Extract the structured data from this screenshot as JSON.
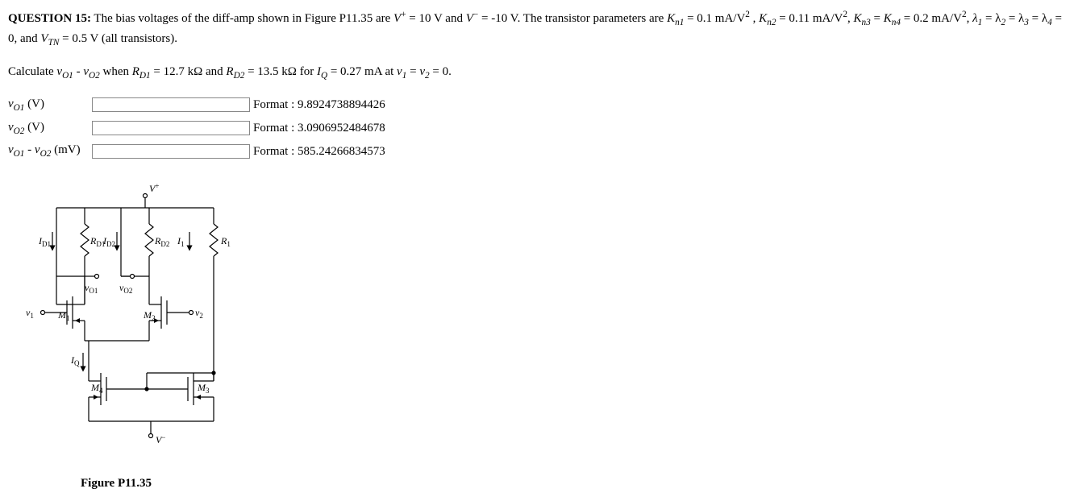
{
  "question": {
    "number": "QUESTION 15:",
    "line1_a": " The bias voltages of the diff-amp shown in Figure P11.35 are ",
    "Vplus_label": "V",
    "Vplus_sup": "+",
    "Vplus_eq": " = 10 V and ",
    "Vminus_label": "V",
    "Vminus_sup": "−",
    "Vminus_eq": " = -10 V. The transistor parameters are ",
    "Kn1": "K",
    "Kn1_sub": "n1",
    "Kn1_eq": " = 0.1 mA/V",
    "sq": "2",
    "comma_sp": " , ",
    "Kn2": "K",
    "Kn2_sub": "n2",
    "Kn2_eq": " = 0.11 mA/V",
    "comma": ", ",
    "Kn3": "K",
    "Kn3_sub": "n3",
    "Kn3_eq": " = ",
    "Kn4": "K",
    "Kn4_sub": "n4",
    "Kn4_eq": " = 0.2 mA/V",
    "lambda1": "λ",
    "lambda1_sub": "1",
    "lambda1_eq": " = ",
    "line2_a": "λ",
    "l2_sub": "2",
    "line2_b": " = λ",
    "l3_sub": "3",
    "line2_c": " = λ",
    "l4_sub": "4",
    "line2_d": " = 0, and ",
    "VTN": "V",
    "VTN_sub": "TN",
    "VTN_eq": " = 0.5 V (all transistors).",
    "calc_a": "Calculate ",
    "vo1": "v",
    "o1_sub": "O1",
    "minus": " - ",
    "vo2": "v",
    "o2_sub": "O2",
    "calc_b": " when ",
    "RD1": "R",
    "RD1_sub": "D1",
    "RD1_eq": " = 12.7 kΩ and ",
    "RD2": "R",
    "RD2_sub": "D2",
    "RD2_eq": " = 13.5 kΩ for ",
    "IQ": "I",
    "IQ_sub": "Q",
    "IQ_eq": " = 0.27 mA at ",
    "v1": "v",
    "v1_sub": "1",
    "v1_eq": " = ",
    "v2": "v",
    "v2_sub": "2",
    "v2_eq": " = 0."
  },
  "answers": [
    {
      "label_var": "v",
      "label_sub": "O1",
      "label_unit": " (V)",
      "format": "Format : 9.8924738894426"
    },
    {
      "label_var": "v",
      "label_sub": "O2",
      "label_unit": " (V)",
      "format": "Format : 3.0906952484678"
    },
    {
      "label_var": "v",
      "label_sub": "O1",
      "label_mid": " - ",
      "label_var2": "v",
      "label_sub2": "O2",
      "label_unit": " (mV)",
      "format": "Format : 585.24266834573"
    }
  ],
  "figure": {
    "caption": "Figure P11.35",
    "labels": {
      "Vplus": "V",
      "Vplus_sup": "+",
      "Vminus": "V",
      "Vminus_sup": "−",
      "ID1": "I",
      "ID1_sub": "D1",
      "ID2": "I",
      "ID2_sub": "D2",
      "RD1": "R",
      "RD1_sub": "D1",
      "RD2": "R",
      "RD2_sub": "D2",
      "I1": "I",
      "I1_sub": "1",
      "R1": "R",
      "R1_sub": "1",
      "vO1": "v",
      "vO1_sub": "O1",
      "vO2": "v",
      "vO2_sub": "O2",
      "v1": "v",
      "v1_sub": "1",
      "v2": "v",
      "v2_sub": "2",
      "M1": "M",
      "M1_sub": "1",
      "M2": "M",
      "M2_sub": "2",
      "M3": "M",
      "M3_sub": "3",
      "M4": "M",
      "M4_sub": "4",
      "IQ": "I",
      "IQ_sub": "Q"
    }
  }
}
